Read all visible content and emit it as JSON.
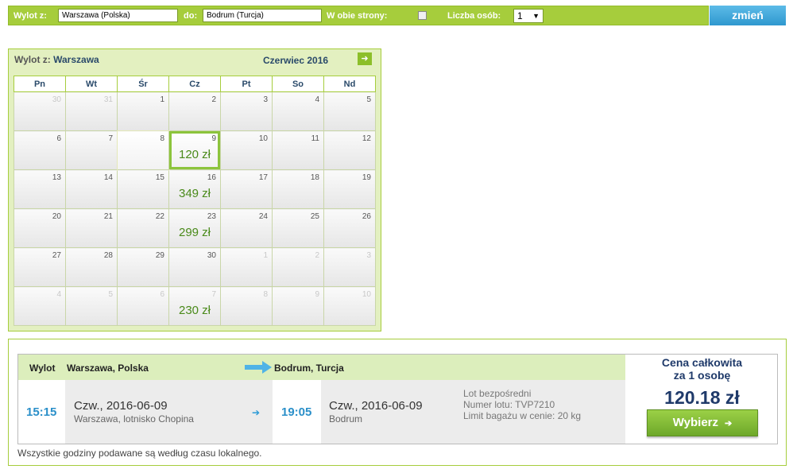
{
  "search": {
    "from_label": "Wylot z:",
    "from_value": "Warszawa (Polska)",
    "to_label": "do:",
    "to_value": "Bodrum (Turcja)",
    "both_ways_label": "W obie strony:",
    "persons_label": "Liczba osób:",
    "persons_value": "1",
    "submit_label": "zmień"
  },
  "calendar": {
    "origin_prefix": "Wylot z:",
    "origin_city": "Warszawa",
    "month_label": "Czerwiec 2016",
    "weekdays": [
      "Pn",
      "Wt",
      "Śr",
      "Cz",
      "Pt",
      "So",
      "Nd"
    ],
    "weeks": [
      [
        {
          "d": "30",
          "o": true
        },
        {
          "d": "31",
          "o": true
        },
        {
          "d": "1"
        },
        {
          "d": "2"
        },
        {
          "d": "3"
        },
        {
          "d": "4"
        },
        {
          "d": "5"
        }
      ],
      [
        {
          "d": "6"
        },
        {
          "d": "7"
        },
        {
          "d": "8",
          "hl": true
        },
        {
          "d": "9",
          "price": "120 zł",
          "sel": true
        },
        {
          "d": "10"
        },
        {
          "d": "11"
        },
        {
          "d": "12"
        }
      ],
      [
        {
          "d": "13"
        },
        {
          "d": "14"
        },
        {
          "d": "15"
        },
        {
          "d": "16",
          "price": "349 zł"
        },
        {
          "d": "17"
        },
        {
          "d": "18"
        },
        {
          "d": "19"
        }
      ],
      [
        {
          "d": "20"
        },
        {
          "d": "21"
        },
        {
          "d": "22"
        },
        {
          "d": "23",
          "price": "299 zł"
        },
        {
          "d": "24"
        },
        {
          "d": "25"
        },
        {
          "d": "26"
        }
      ],
      [
        {
          "d": "27"
        },
        {
          "d": "28"
        },
        {
          "d": "29"
        },
        {
          "d": "30"
        },
        {
          "d": "1",
          "o": true
        },
        {
          "d": "2",
          "o": true
        },
        {
          "d": "3",
          "o": true
        }
      ],
      [
        {
          "d": "4",
          "o": true
        },
        {
          "d": "5",
          "o": true
        },
        {
          "d": "6",
          "o": true
        },
        {
          "d": "7",
          "o": true,
          "price": "230 zł"
        },
        {
          "d": "8",
          "o": true
        },
        {
          "d": "9",
          "o": true
        },
        {
          "d": "10",
          "o": true
        }
      ]
    ]
  },
  "flight": {
    "header_label": "Wylot",
    "origin": "Warszawa, Polska",
    "destination": "Bodrum, Turcja",
    "dep_time": "15:15",
    "dep_date": "Czw., 2016-06-09",
    "dep_place": "Warszawa, lotnisko Chopina",
    "arr_time": "19:05",
    "arr_date": "Czw., 2016-06-09",
    "arr_place": "Bodrum",
    "info_direct": "Lot bezpośredni",
    "info_flight_no": "Numer lotu: TVP7210",
    "info_baggage": "Limit bagażu w cenie: 20 kg"
  },
  "price": {
    "label_line1": "Cena całkowita",
    "label_line2": "za 1 osobę",
    "amount": "120.18 zł",
    "select_label": "Wybierz"
  },
  "footer_note": "Wszystkie godziny podawane są według czasu lokalnego.",
  "colors": {
    "accent_green": "#a6cd3c",
    "link_blue": "#2a8fc9",
    "price_navy": "#1f3a6a"
  }
}
